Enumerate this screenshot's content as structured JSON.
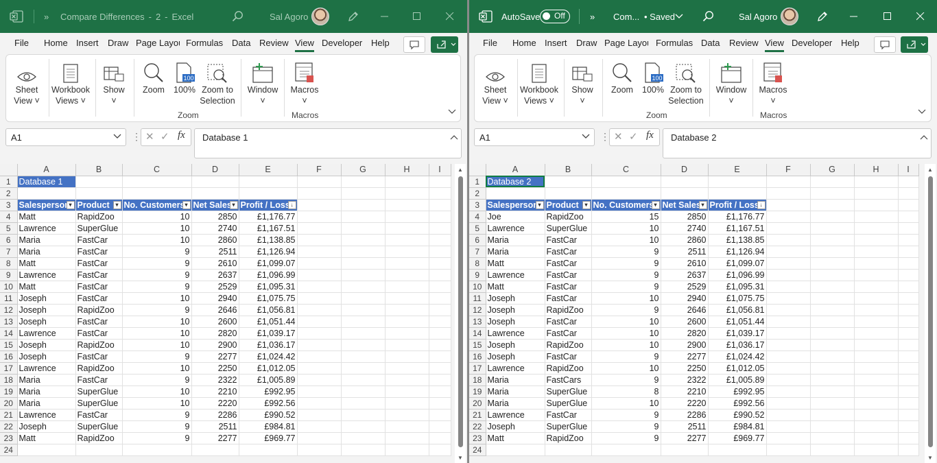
{
  "left": {
    "title": {
      "file_name": "Compare Differences",
      "sep1": "-",
      "count": "2",
      "sep2": "-",
      "app": "Excel",
      "user": "Sal Agoro"
    },
    "tabs": [
      "File",
      "Home",
      "Insert",
      "Draw",
      "Page Layout",
      "Formulas",
      "Data",
      "Review",
      "View",
      "Developer",
      "Help"
    ],
    "active_tab": "View",
    "ribbon": {
      "sheet_view": [
        "Sheet",
        "View"
      ],
      "workbook_views": [
        "Workbook",
        "Views"
      ],
      "show": "Show",
      "zoom": "Zoom",
      "hundred": "100%",
      "zoom_sel": [
        "Zoom to",
        "Selection"
      ],
      "window": "Window",
      "macros": "Macros",
      "group_zoom": "Zoom",
      "group_macros": "Macros"
    },
    "namebox": "A1",
    "formula": "Database 1",
    "cols": [
      "A",
      "B",
      "C",
      "D",
      "E",
      "F",
      "G",
      "H",
      "I"
    ],
    "a1": "Database 1",
    "headers": [
      "Salesperson",
      "Product",
      "No. Customers",
      "Net Sales",
      "Profit / Loss"
    ],
    "rows": [
      [
        "Matt",
        "RapidZoo",
        "10",
        "2850",
        "£1,176.77"
      ],
      [
        "Lawrence",
        "SuperGlue",
        "10",
        "2740",
        "£1,167.51"
      ],
      [
        "Maria",
        "FastCar",
        "10",
        "2860",
        "£1,138.85"
      ],
      [
        "Maria",
        "FastCar",
        "9",
        "2511",
        "£1,126.94"
      ],
      [
        "Matt",
        "FastCar",
        "9",
        "2610",
        "£1,099.07"
      ],
      [
        "Lawrence",
        "FastCar",
        "9",
        "2637",
        "£1,096.99"
      ],
      [
        "Matt",
        "FastCar",
        "9",
        "2529",
        "£1,095.31"
      ],
      [
        "Joseph",
        "FastCar",
        "10",
        "2940",
        "£1,075.75"
      ],
      [
        "Joseph",
        "RapidZoo",
        "9",
        "2646",
        "£1,056.81"
      ],
      [
        "Joseph",
        "FastCar",
        "10",
        "2600",
        "£1,051.44"
      ],
      [
        "Lawrence",
        "FastCar",
        "10",
        "2820",
        "£1,039.17"
      ],
      [
        "Joseph",
        "RapidZoo",
        "10",
        "2900",
        "£1,036.17"
      ],
      [
        "Joseph",
        "FastCar",
        "9",
        "2277",
        "£1,024.42"
      ],
      [
        "Lawrence",
        "RapidZoo",
        "10",
        "2250",
        "£1,012.05"
      ],
      [
        "Maria",
        "FastCar",
        "9",
        "2322",
        "£1,005.89"
      ],
      [
        "Maria",
        "SuperGlue",
        "10",
        "2210",
        "£992.95"
      ],
      [
        "Maria",
        "SuperGlue",
        "10",
        "2220",
        "£992.56"
      ],
      [
        "Lawrence",
        "FastCar",
        "9",
        "2286",
        "£990.52"
      ],
      [
        "Joseph",
        "SuperGlue",
        "9",
        "2511",
        "£984.81"
      ],
      [
        "Matt",
        "RapidZoo",
        "9",
        "2277",
        "£969.77"
      ]
    ]
  },
  "right": {
    "title": {
      "autosave": "AutoSave",
      "toggle": "Off",
      "file_name": "Com...",
      "saved": "• Saved",
      "user": "Sal Agoro"
    },
    "tabs": [
      "File",
      "Home",
      "Insert",
      "Draw",
      "Page Layout",
      "Formulas",
      "Data",
      "Review",
      "View",
      "Developer",
      "Help"
    ],
    "active_tab": "View",
    "ribbon": {
      "sheet_view": [
        "Sheet",
        "View"
      ],
      "workbook_views": [
        "Workbook",
        "Views"
      ],
      "show": "Show",
      "zoom": "Zoom",
      "hundred": "100%",
      "zoom_sel": [
        "Zoom to",
        "Selection"
      ],
      "window": "Window",
      "macros": "Macros",
      "group_zoom": "Zoom",
      "group_macros": "Macros"
    },
    "namebox": "A1",
    "formula": "Database 2",
    "cols": [
      "A",
      "B",
      "C",
      "D",
      "E",
      "F",
      "G",
      "H",
      "I"
    ],
    "a1": "Database 2",
    "headers": [
      "Salesperson",
      "Product",
      "No. Customers",
      "Net Sales",
      "Profit / Loss"
    ],
    "rows": [
      [
        "Joe",
        "RapidZoo",
        "15",
        "2850",
        "£1,176.77"
      ],
      [
        "Lawrence",
        "SuperGlue",
        "10",
        "2740",
        "£1,167.51"
      ],
      [
        "Maria",
        "FastCar",
        "10",
        "2860",
        "£1,138.85"
      ],
      [
        "Maria",
        "FastCar",
        "9",
        "2511",
        "£1,126.94"
      ],
      [
        "Matt",
        "FastCar",
        "9",
        "2610",
        "£1,099.07"
      ],
      [
        "Lawrence",
        "FastCar",
        "9",
        "2637",
        "£1,096.99"
      ],
      [
        "Matt",
        "FastCar",
        "9",
        "2529",
        "£1,095.31"
      ],
      [
        "Joseph",
        "FastCar",
        "10",
        "2940",
        "£1,075.75"
      ],
      [
        "Joseph",
        "RapidZoo",
        "9",
        "2646",
        "£1,056.81"
      ],
      [
        "Joseph",
        "FastCar",
        "10",
        "2600",
        "£1,051.44"
      ],
      [
        "Lawrence",
        "FastCar",
        "10",
        "2820",
        "£1,039.17"
      ],
      [
        "Joseph",
        "RapidZoo",
        "10",
        "2900",
        "£1,036.17"
      ],
      [
        "Joseph",
        "FastCar",
        "9",
        "2277",
        "£1,024.42"
      ],
      [
        "Lawrence",
        "RapidZoo",
        "10",
        "2250",
        "£1,012.05"
      ],
      [
        "Maria",
        "FastCars",
        "9",
        "2322",
        "£1,005.89"
      ],
      [
        "Maria",
        "SuperGlue",
        "8",
        "2210",
        "£992.95"
      ],
      [
        "Maria",
        "SuperGlue",
        "10",
        "2220",
        "£992.56"
      ],
      [
        "Lawrence",
        "FastCar",
        "9",
        "2286",
        "£990.52"
      ],
      [
        "Joseph",
        "SuperGlue",
        "9",
        "2511",
        "£984.81"
      ],
      [
        "Matt",
        "RapidZoo",
        "9",
        "2277",
        "£969.77"
      ]
    ]
  },
  "colors": {
    "excel_green": "#1e7145",
    "table_header": "#4472c4",
    "selection": "#107c41"
  }
}
